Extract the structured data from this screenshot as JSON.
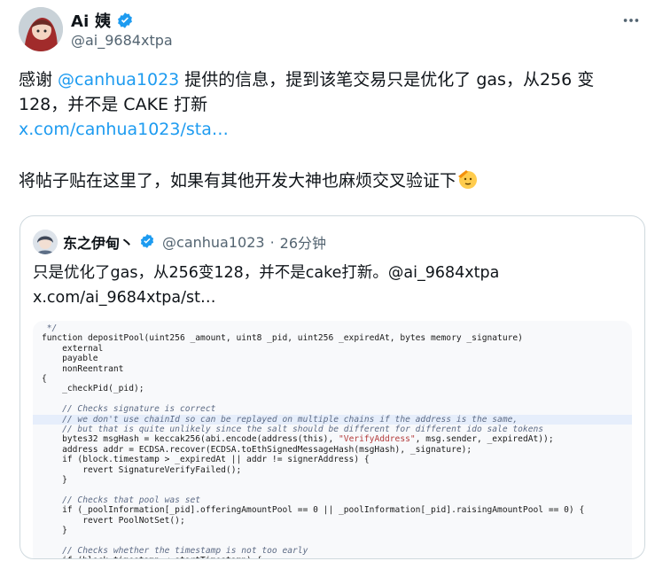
{
  "author": {
    "name": "Ai 姨",
    "handle": "@ai_9684xtpa"
  },
  "tweet": {
    "p1_a": "感谢 ",
    "p1_mention": "@canhua1023",
    "p1_b": " 提供的信息，提到该笔交易只是优化了 gas，从256 变",
    "p1_c": "128，并不是 CAKE 打新",
    "link": "x.com/canhua1023/sta…",
    "p2": "将帖子贴在这里了，如果有其他开发大神也麻烦交叉验证下"
  },
  "quote": {
    "name": "东之伊甸丶",
    "handle": "@canhua1023",
    "dot": "·",
    "time": "26分钟",
    "line1": "只是优化了gas，从256变128，并不是cake打新。@ai_9684xtpa",
    "line2": "x.com/ai_9684xtpa/st…"
  },
  "code": {
    "lines": [
      " */",
      "function depositPool(uint256 _amount, uint8 _pid, uint256 _expiredAt, bytes memory _signature)",
      "    external",
      "    payable",
      "    nonReentrant",
      "{",
      "    _checkPid(_pid);",
      "",
      "    // Checks signature is correct",
      "    // we don't use chainId so can be replayed on multiple chains if the address is the same,",
      "    // but that is quite unlikely since the salt should be different for different ido sale tokens",
      "    bytes32 msgHash = keccak256(abi.encode(address(this), \"VerifyAddress\", msg.sender, _expiredAt));",
      "    address addr = ECDSA.recover(ECDSA.toEthSignedMessageHash(msgHash), _signature);",
      "    if (block.timestamp > _expiredAt || addr != signerAddress) {",
      "        revert SignatureVerifyFailed();",
      "    }",
      "",
      "    // Checks that pool was set",
      "    if (_poolInformation[_pid].offeringAmountPool == 0 || _poolInformation[_pid].raisingAmountPool == 0) {",
      "        revert PoolNotSet();",
      "    }",
      "",
      "    // Checks whether the timestamp is not too early",
      "    if (block.timestamp < startTimestamp) {"
    ]
  },
  "colors": {
    "link": "#1d9bf0",
    "secondary_text": "#536471",
    "border": "#cfd9de",
    "verified": "#1d9bf0"
  }
}
